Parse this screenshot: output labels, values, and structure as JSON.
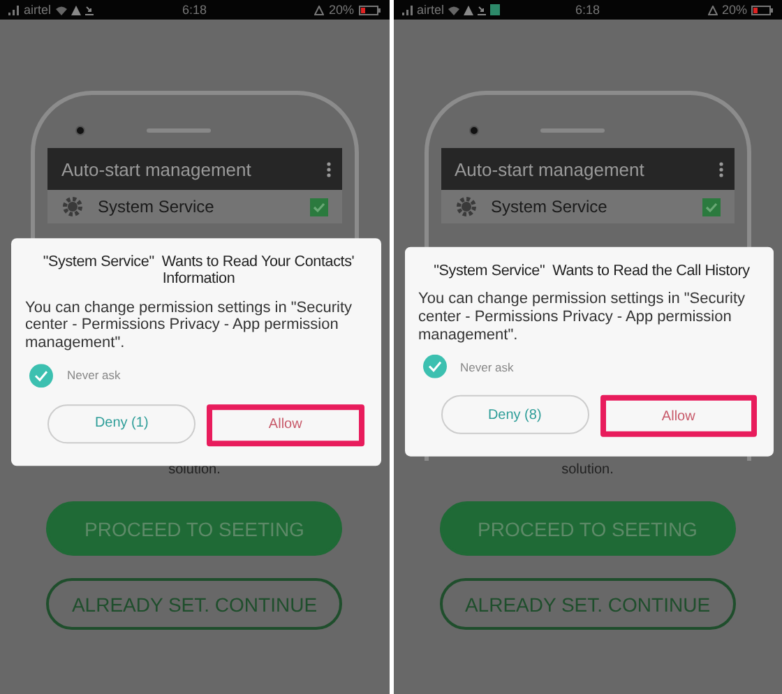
{
  "panels": [
    {
      "status_bar": {
        "carrier": "airtel",
        "app_notification": false,
        "time": "6:18",
        "battery": "20%"
      },
      "background_app": {
        "header": "Auto-start management",
        "row_label": "System Service",
        "row_checked": true,
        "footer_text": "solution.",
        "buttons": [
          {
            "label": "PROCEED TO SEETING",
            "kind": "filled"
          },
          {
            "label": "ALREADY SET. CONTINUE",
            "kind": "outline"
          }
        ]
      },
      "dialog": {
        "title": "\"System Service\"  Wants to Read Your Contacts' Information",
        "message": "You can change permission settings in \"Security center - Permissions Privacy - App permission management\".",
        "never_ask": {
          "label": "Never ask",
          "checked": true
        },
        "buttons": [
          {
            "label": "Deny (1)",
            "kind": "negative",
            "highlighted": false
          },
          {
            "label": "Allow",
            "kind": "positive",
            "highlighted": true
          }
        ]
      }
    },
    {
      "status_bar": {
        "carrier": "airtel",
        "app_notification": true,
        "time": "6:18",
        "battery": "20%"
      },
      "background_app": {
        "header": "Auto-start management",
        "row_label": "System Service",
        "row_checked": true,
        "footer_text": "solution.",
        "buttons": [
          {
            "label": "PROCEED TO SEETING",
            "kind": "filled"
          },
          {
            "label": "ALREADY SET. CONTINUE",
            "kind": "outline"
          }
        ]
      },
      "dialog": {
        "title": "\"System Service\"  Wants to Read the Call History",
        "message": "You can change permission settings in \"Security center - Permissions Privacy - App permission management\".",
        "never_ask": {
          "label": "Never ask",
          "checked": true
        },
        "buttons": [
          {
            "label": "Deny (8)",
            "kind": "negative",
            "highlighted": false
          },
          {
            "label": "Allow",
            "kind": "positive",
            "highlighted": true
          }
        ]
      }
    }
  ]
}
